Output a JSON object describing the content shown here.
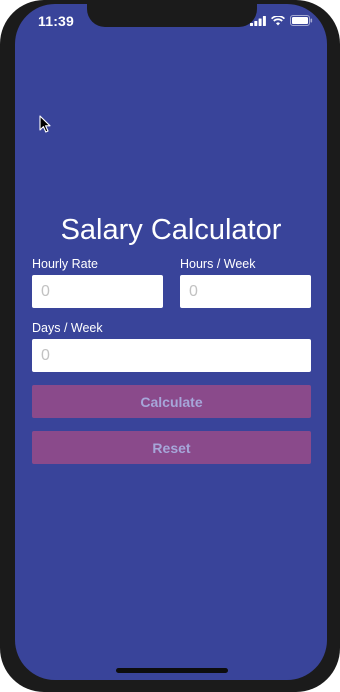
{
  "status_bar": {
    "time": "11:39",
    "icons": [
      "signal-icon",
      "wifi-icon",
      "battery-icon"
    ]
  },
  "app": {
    "title": "Salary Calculator",
    "fields": {
      "hourly_rate": {
        "label": "Hourly Rate",
        "placeholder": "0",
        "value": ""
      },
      "hours_week": {
        "label": "Hours / Week",
        "placeholder": "0",
        "value": ""
      },
      "days_week": {
        "label": "Days / Week",
        "placeholder": "0",
        "value": ""
      }
    },
    "buttons": {
      "calculate": "Calculate",
      "reset": "Reset"
    }
  },
  "colors": {
    "background": "#39449a",
    "button": "#8a4a8b",
    "button_text": "#a6a6d9",
    "device_frame": "#1b1b1b"
  }
}
